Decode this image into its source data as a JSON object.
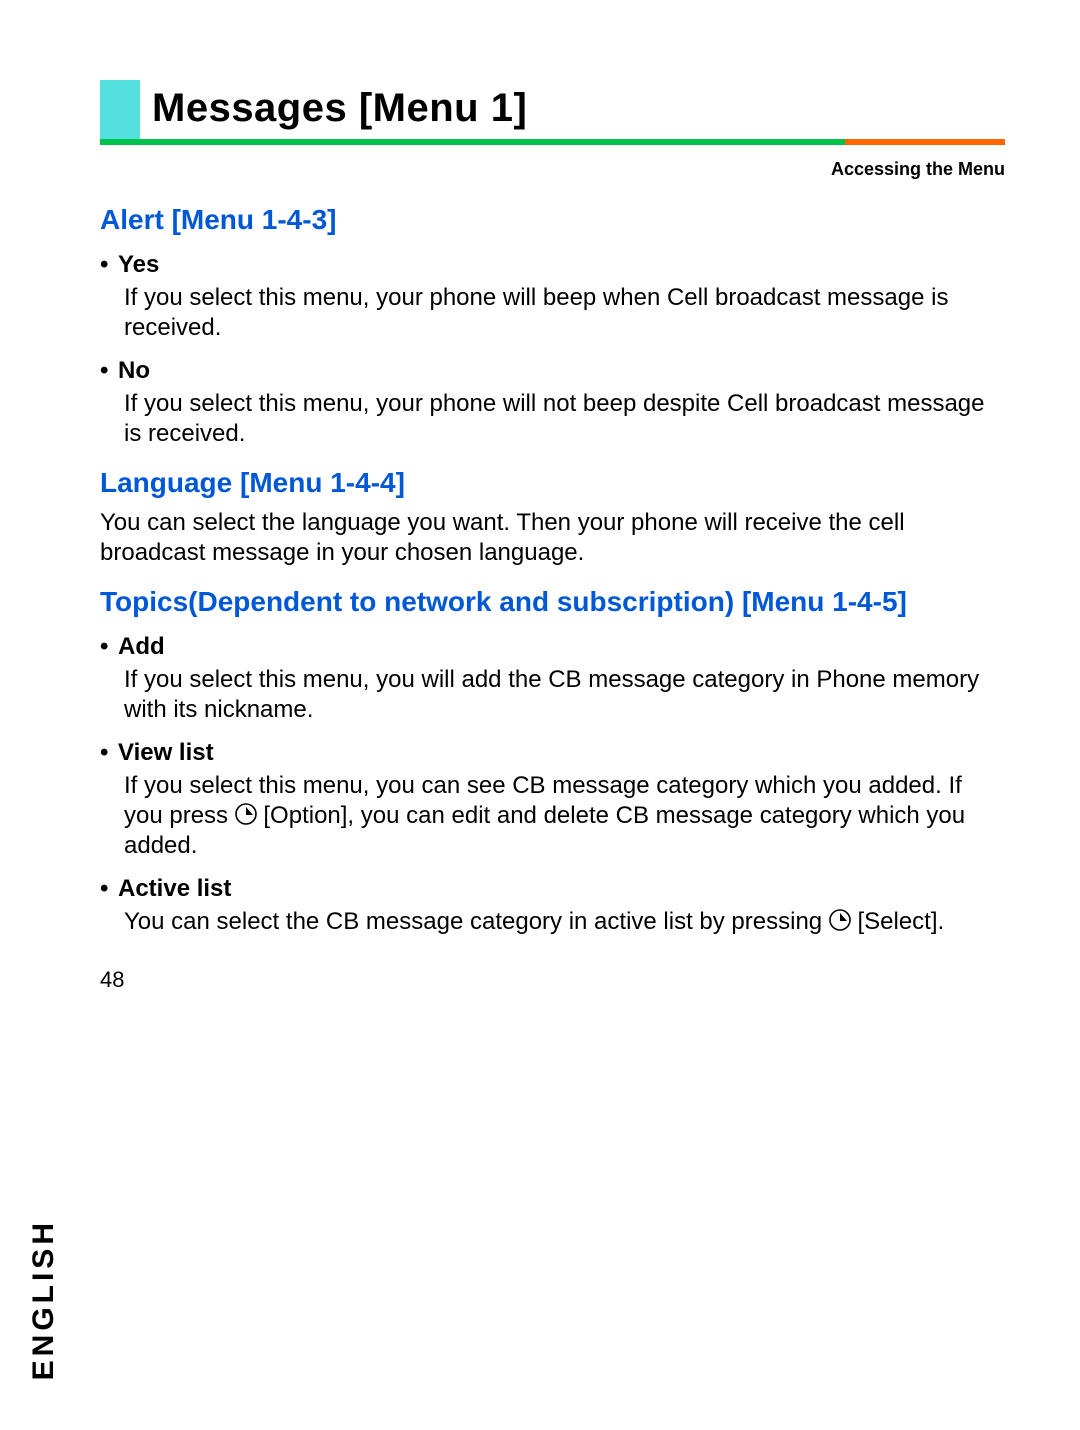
{
  "header": {
    "title": "Messages [Menu 1]",
    "subhead": "Accessing the Menu"
  },
  "sections": [
    {
      "heading": "Alert [Menu 1-4-3]",
      "items": [
        {
          "label": "Yes",
          "body_parts": [
            "If you select this menu, your phone will beep when Cell broadcast message is received."
          ]
        },
        {
          "label": "No",
          "body_parts": [
            "If you select this menu, your phone will not beep despite Cell broadcast message is received."
          ]
        }
      ]
    },
    {
      "heading": "Language [Menu 1-4-4]",
      "intro_parts": [
        "You can select the language you want. Then your phone will receive the cell broadcast message in your chosen language."
      ],
      "items": []
    },
    {
      "heading": "Topics(Dependent to network and subscription) [Menu 1-4-5]",
      "items": [
        {
          "label": "Add",
          "body_parts": [
            "If you select this menu, you will add the CB message category in Phone memory with its nickname."
          ]
        },
        {
          "label": "View list",
          "body_parts": [
            "If you select this menu, you can see CB message category which you added. If you press ",
            {
              "icon": "softkey-icon"
            },
            " [Option], you can edit and delete CB message category which you added."
          ]
        },
        {
          "label": "Active list",
          "body_parts": [
            "You can select the CB message category in active list by pressing ",
            {
              "icon": "softkey-icon"
            },
            " [Select]."
          ]
        }
      ]
    }
  ],
  "margin": {
    "language": "ENGLISH",
    "page_number": "48"
  }
}
